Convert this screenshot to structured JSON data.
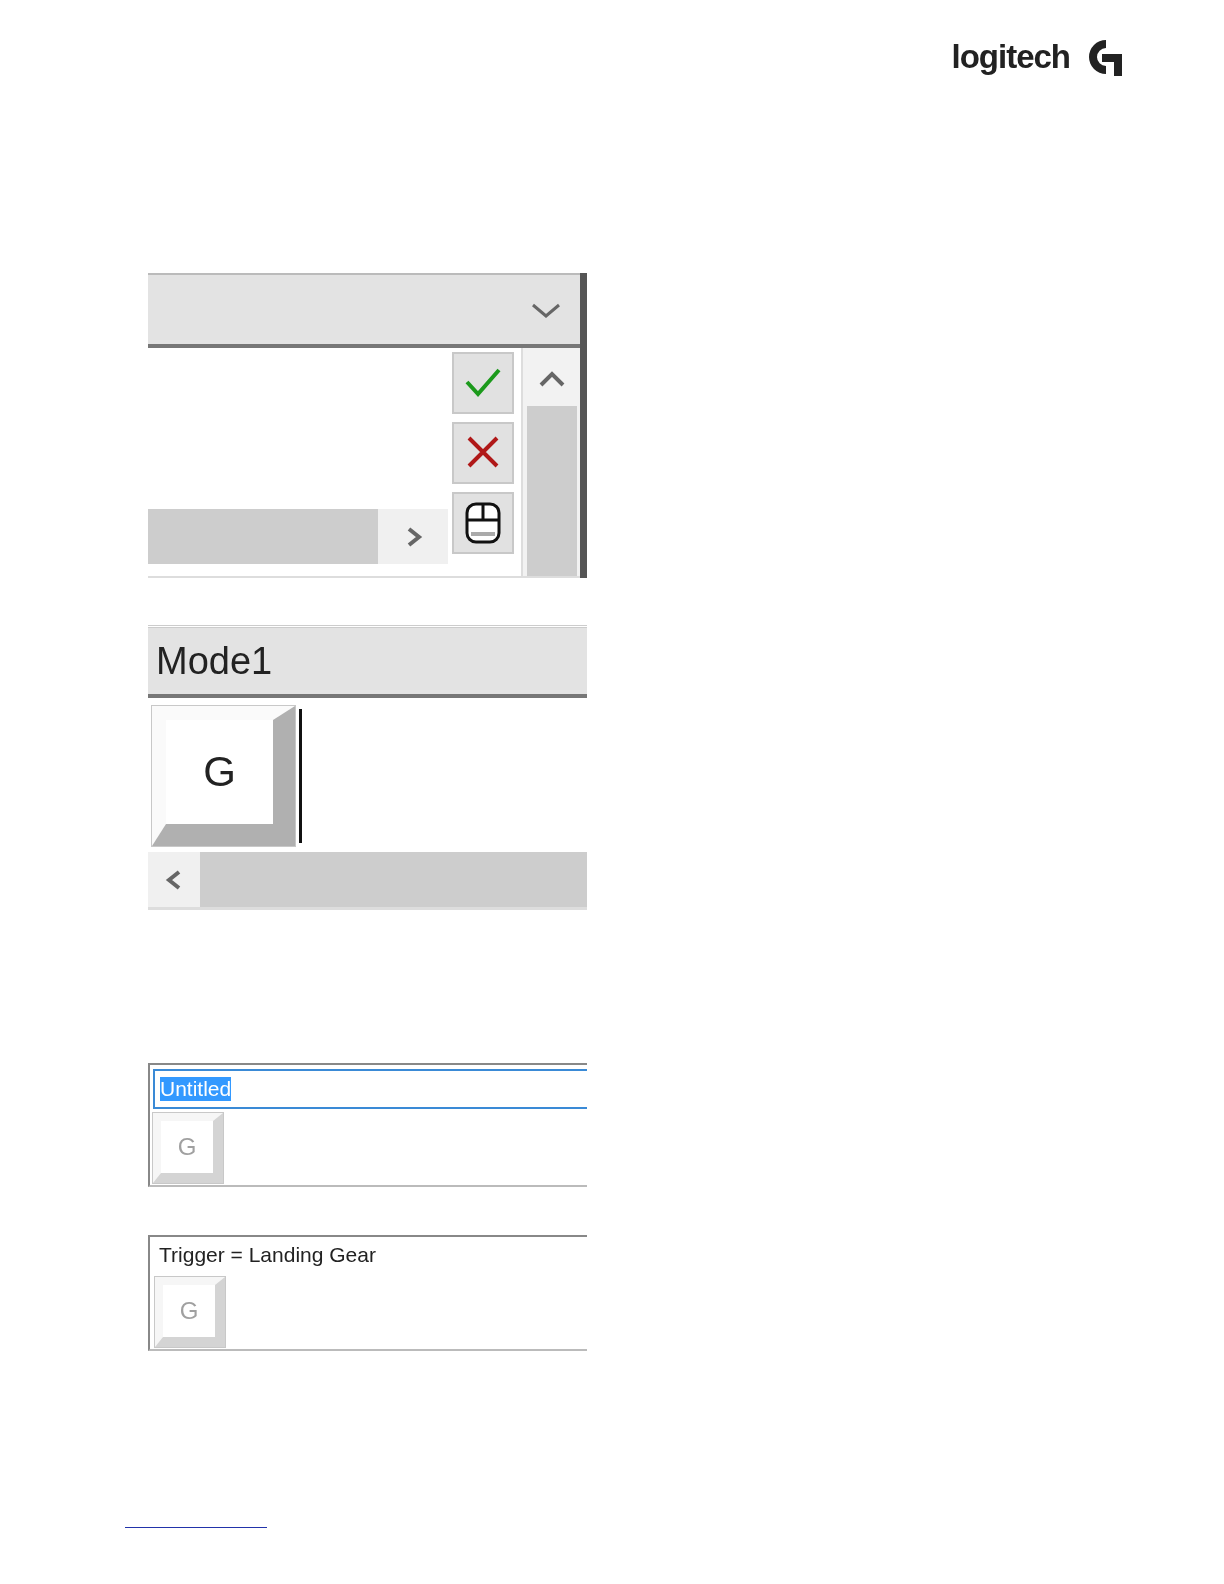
{
  "logo": {
    "text": "logitech"
  },
  "panels": [
    {
      "kind": "editor",
      "buttons": [
        {
          "kind": "confirm"
        },
        {
          "kind": "cancel"
        },
        {
          "kind": "mouse"
        }
      ]
    },
    {
      "kind": "mode",
      "title": "Mode1",
      "key": {
        "label": "G",
        "disabled": false
      }
    },
    {
      "kind": "name_field",
      "value": "Untitled",
      "value_selected": true,
      "key": {
        "label": "G",
        "disabled": true
      }
    },
    {
      "kind": "label",
      "text": "Trigger = Landing Gear",
      "key": {
        "label": "G",
        "disabled": true
      }
    }
  ]
}
